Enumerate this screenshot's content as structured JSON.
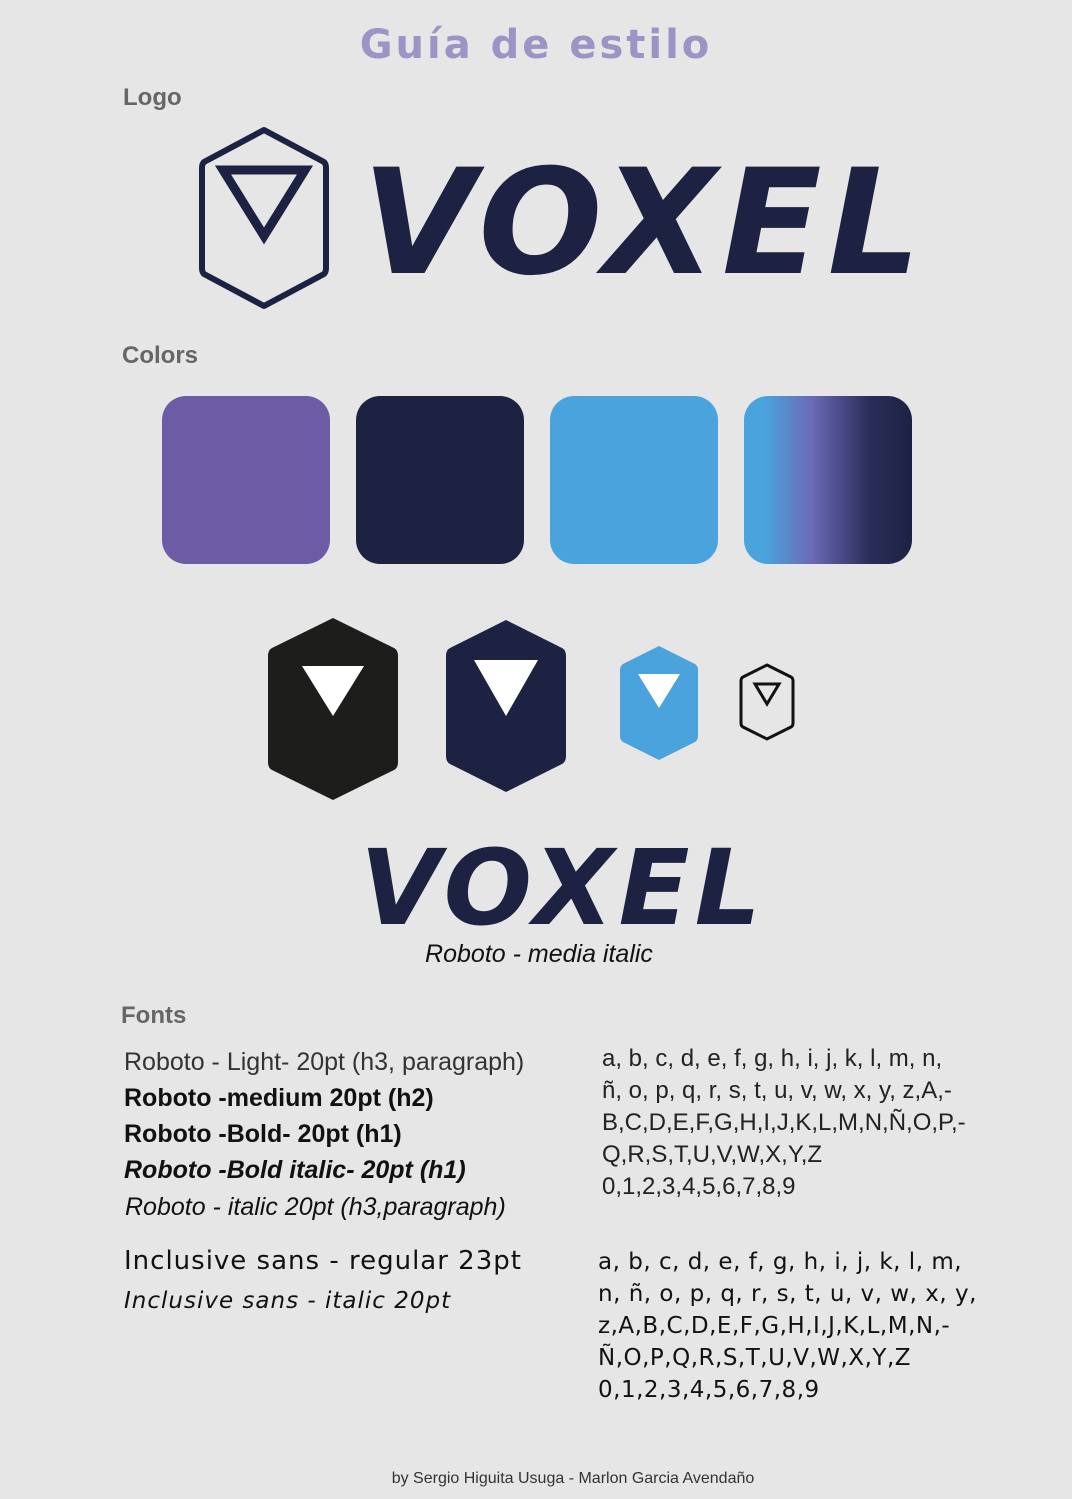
{
  "title": "Guía de estilo",
  "sections": {
    "logo": "Logo",
    "colors": "Colors",
    "fonts": "Fonts"
  },
  "logo": {
    "wordmark": "VOXEL",
    "wordmark_secondary": "VOXEL",
    "caption": "Roboto - media italic"
  },
  "palette": {
    "purple": "#6b5ca5",
    "navy": "#1d2243",
    "blue": "#4aa3dc",
    "gradient": [
      "#4aa3dc",
      "#6b6bb8",
      "#1d2243"
    ],
    "black": "#1d1d1b"
  },
  "fonts": {
    "roboto_lines": [
      "Roboto - Light- 20pt  (h3, paragraph)",
      "Roboto -medium 20pt (h2)",
      "Roboto -Bold- 20pt (h1)",
      "Roboto -Bold italic- 20pt (h1)",
      "Roboto - italic 20pt (h3,paragraph)"
    ],
    "roboto_glyphs": [
      "a, b, c, d, e, f, g, h, i, j, k, l, m, n,",
      "ñ, o, p, q, r, s, t, u, v, w, x, y, z,A,-",
      "B,C,D,E,F,G,H,I,J,K,L,M,N,Ñ,O,P,-",
      "Q,R,S,T,U,V,W,X,Y,Z",
      "0,1,2,3,4,5,6,7,8,9"
    ],
    "inclusive_lines": [
      "Inclusive sans - regular 23pt",
      "Inclusive sans - italic 20pt"
    ],
    "inclusive_glyphs": [
      "a, b, c, d, e, f, g, h, i, j, k, l, m,",
      "n, ñ, o, p, q, r, s, t, u, v, w, x, y,",
      "z,A,B,C,D,E,F,G,H,I,J,K,L,M,N,-",
      "Ñ,O,P,Q,R,S,T,U,V,W,X,Y,Z",
      "0,1,2,3,4,5,6,7,8,9"
    ]
  },
  "credit": "by Sergio Higuita Usuga - Marlon Garcia Avendaño"
}
